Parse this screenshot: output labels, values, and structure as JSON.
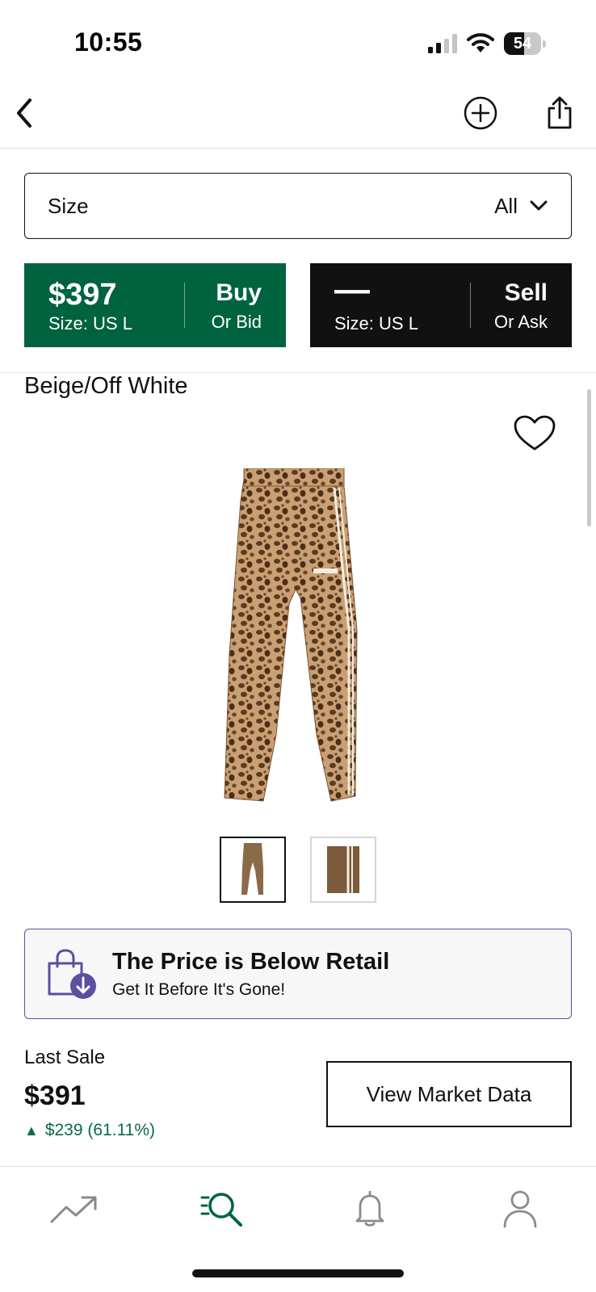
{
  "status_bar": {
    "time": "10:55",
    "battery_level": "54",
    "battery_fraction": 0.54
  },
  "nav": {
    "back_icon": "chevron-left-icon",
    "add_icon": "plus-circle-icon",
    "share_icon": "share-icon"
  },
  "size_selector": {
    "label": "Size",
    "value": "All"
  },
  "buy": {
    "price": "$397",
    "size": "Size: US L",
    "title": "Buy",
    "subtitle": "Or Bid",
    "color": "#006340"
  },
  "sell": {
    "price": "—",
    "size": "Size: US L",
    "title": "Sell",
    "subtitle": "Or Ask",
    "color": "#111111"
  },
  "product": {
    "colorway": "Beige/Off White",
    "thumbnails_count": 2,
    "selected_thumbnail": 1
  },
  "promo": {
    "title": "The Price is Below Retail",
    "subtitle": "Get It Before It's Gone!",
    "accent_color": "#5a4fa0"
  },
  "last_sale": {
    "label": "Last Sale",
    "price": "$391",
    "change": "$239 (61.11%)",
    "change_color": "#0a6b45",
    "market_button": "View Market Data"
  },
  "tab_bar": {
    "tabs": [
      "trending-icon",
      "search-icon",
      "bell-icon",
      "profile-icon"
    ],
    "active": "search-icon",
    "active_color": "#006340"
  }
}
